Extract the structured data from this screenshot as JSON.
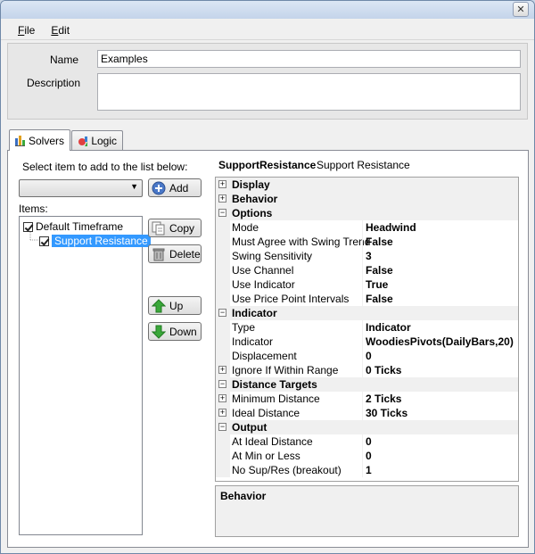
{
  "window": {
    "close_glyph": "✕"
  },
  "menu": {
    "items": [
      "File",
      "Edit"
    ]
  },
  "header": {
    "name_label": "Name",
    "name_value": "Examples",
    "description_label": "Description",
    "description_value": ""
  },
  "tabs": [
    {
      "label": "Solvers",
      "icon": "bar-chart-icon",
      "active": true
    },
    {
      "label": "Logic",
      "icon": "logic-shapes-icon",
      "active": false
    }
  ],
  "solvers": {
    "select_prompt": "Select item to add to the list below:",
    "combo_value": "",
    "add_label": "Add",
    "items_label": "Items:",
    "tree": [
      {
        "label": "Default Timeframe",
        "checked": true,
        "level": 0
      },
      {
        "label": "Support Resistance",
        "checked": true,
        "level": 1,
        "selected": true
      }
    ],
    "copy_label": "Copy",
    "delete_label": "Delete",
    "up_label": "Up",
    "down_label": "Down"
  },
  "properties": {
    "object_type": "SupportResistance",
    "object_name": "Support Resistance",
    "rows": [
      {
        "kind": "cat",
        "name": "Display",
        "exp": "+"
      },
      {
        "kind": "cat",
        "name": "Behavior",
        "exp": "+"
      },
      {
        "kind": "cat",
        "name": "Options",
        "exp": "−"
      },
      {
        "kind": "prop",
        "name": "Mode",
        "value": "Headwind"
      },
      {
        "kind": "prop",
        "name": "Must Agree with Swing Trend",
        "value": "False"
      },
      {
        "kind": "prop",
        "name": "Swing Sensitivity",
        "value": "3"
      },
      {
        "kind": "prop",
        "name": "Use Channel",
        "value": "False"
      },
      {
        "kind": "prop",
        "name": "Use Indicator",
        "value": "True"
      },
      {
        "kind": "prop",
        "name": "Use Price Point Intervals",
        "value": "False"
      },
      {
        "kind": "cat",
        "name": "Indicator",
        "exp": "−"
      },
      {
        "kind": "prop",
        "name": "Type",
        "value": "Indicator"
      },
      {
        "kind": "prop",
        "name": "Indicator",
        "value": "WoodiesPivots(DailyBars,20)"
      },
      {
        "kind": "prop",
        "name": "Displacement",
        "value": "0"
      },
      {
        "kind": "prop",
        "name": "Ignore If Within Range",
        "value": "0 Ticks",
        "exp": "+"
      },
      {
        "kind": "cat",
        "name": "Distance Targets",
        "exp": "−"
      },
      {
        "kind": "prop",
        "name": "Minimum Distance",
        "value": "2 Ticks",
        "exp": "+"
      },
      {
        "kind": "prop",
        "name": "Ideal Distance",
        "value": "30 Ticks",
        "exp": "+"
      },
      {
        "kind": "cat",
        "name": "Output",
        "exp": "−"
      },
      {
        "kind": "prop",
        "name": "At Ideal Distance",
        "value": "0"
      },
      {
        "kind": "prop",
        "name": "At Min or Less",
        "value": "0"
      },
      {
        "kind": "prop",
        "name": "No Sup/Res (breakout)",
        "value": "1"
      }
    ],
    "description_title": "Behavior"
  },
  "colors": {
    "selection": "#3399ff",
    "add_icon": "#4a78c8",
    "up_arrow": "#3aa83a",
    "down_arrow": "#3aa83a"
  }
}
